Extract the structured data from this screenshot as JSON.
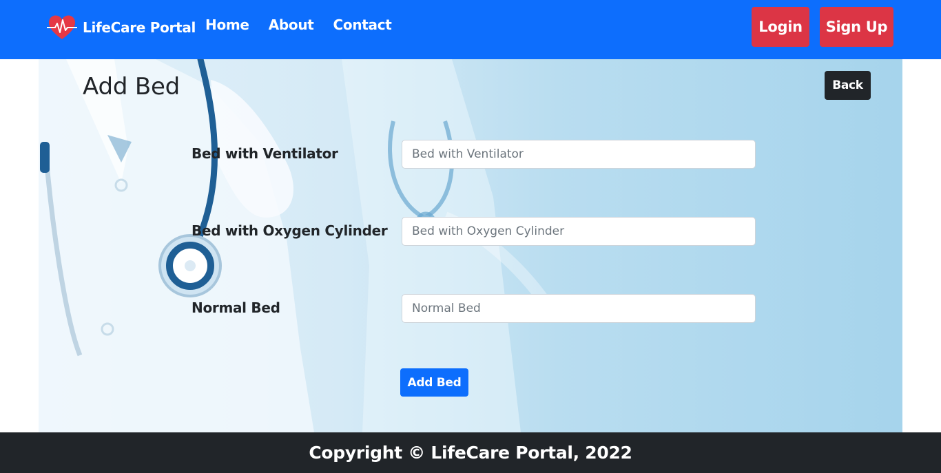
{
  "navbar": {
    "brand": "LifeCare Portal",
    "brand_icon": "heart-pulse-icon",
    "links": [
      "Home",
      "About",
      "Contact"
    ],
    "login_label": "Login",
    "signup_label": "Sign Up",
    "bg_color": "#0d6efd",
    "auth_color": "#dc3545"
  },
  "main": {
    "title": "Add Bed",
    "back_label": "Back",
    "fields": [
      {
        "label": "Bed with Ventilator",
        "placeholder": "Bed with Ventilator",
        "value": ""
      },
      {
        "label": "Bed with Oxygen Cylinder",
        "placeholder": "Bed with Oxygen Cylinder",
        "value": ""
      },
      {
        "label": "Normal Bed",
        "placeholder": "Normal Bed",
        "value": ""
      }
    ],
    "submit_label": "Add Bed",
    "submit_color": "#0d6efd"
  },
  "footer": {
    "text": "Copyright © LifeCare Portal, 2022",
    "bg_color": "#212529"
  }
}
